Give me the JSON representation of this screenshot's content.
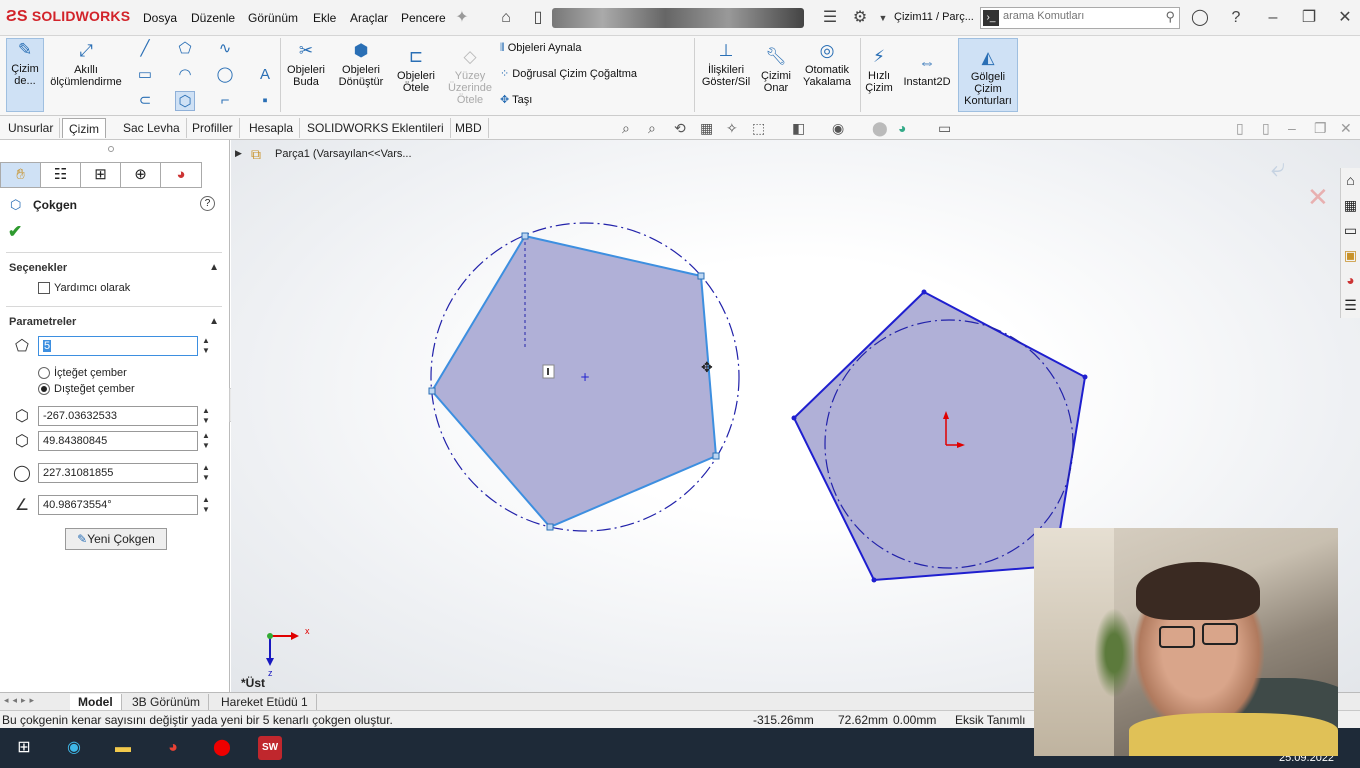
{
  "titlebar": {
    "logo": "SOLIDWORKS",
    "menus": [
      "Dosya",
      "Düzenle",
      "Görünüm",
      "Ekle",
      "Araçlar",
      "Pencere"
    ],
    "doc_title": "Çizim11 / Parç...",
    "search_placeholder": "arama Komutları"
  },
  "ribbon": {
    "sketch_btn": "Çizim de...",
    "smart_dim": "Akıllı ölçümlendirme",
    "trim": "Objeleri Buda",
    "convert": "Objeleri Dönüştür",
    "offset": "Objeleri Ötele",
    "surface_offset": "Yüzey Üzerinde Ötele",
    "mirror": "Objeleri Aynala",
    "linear_pattern": "Doğrusal Çizim Çoğaltma",
    "move": "Taşı",
    "relations": "İlişkileri Göster/Sil",
    "repair": "Çizimi Onar",
    "snap": "Otomatik Yakalama",
    "rapid": "Hızlı Çizim",
    "instant2d": "Instant2D",
    "shaded": "Gölgeli Çizim Konturları"
  },
  "tabs": [
    "Unsurlar",
    "Çizim",
    "Sac Levha",
    "Profiller",
    "Hesapla",
    "SOLIDWORKS Eklentileri",
    "MBD"
  ],
  "panel": {
    "title": "Çokgen",
    "options_header": "Seçenekler",
    "construction_label": "Yardımcı olarak",
    "params_header": "Parametreler",
    "sides": "5",
    "inscribed": "İçteğet çember",
    "circumscribed": "Dışteğet çember",
    "cx": "-267.03632533",
    "cy": "49.84380845",
    "diameter": "227.31081855",
    "angle": "40.98673554°",
    "new_polygon": "Yeni Çokgen"
  },
  "tree": {
    "item": "Parça1  (Varsayılan<<Vars..."
  },
  "view_label": "*Üst",
  "axes": {
    "x": "x",
    "z": "z"
  },
  "bottom_tabs": [
    "Model",
    "3B Görünüm",
    "Hareket Etüdü 1"
  ],
  "status": {
    "message": "Bu çokgenin kenar sayısını değiştir yada yeni bir 5 kenarlı çokgen oluştur.",
    "x": "-315.26mm",
    "y": "72.62mm",
    "z": "0.00mm",
    "state": "Eksik Tanımlı"
  },
  "taskbar": {
    "date": "25.09.2022"
  },
  "colors": {
    "accent": "#2a6fb5",
    "polygon_fill": "#a9a9d4",
    "polygon_edge": "#1f1fcf",
    "selected_edge": "#3d8fe0"
  }
}
